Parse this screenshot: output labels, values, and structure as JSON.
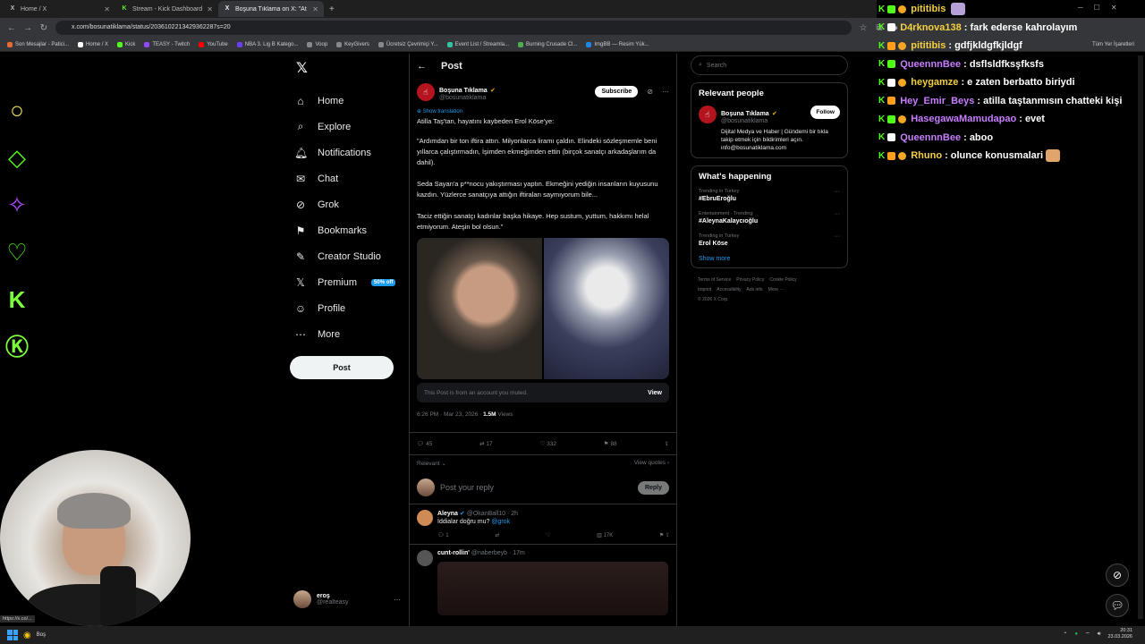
{
  "browser": {
    "tabs": [
      {
        "icon": "X",
        "label": "Home / X",
        "color": "#ffffff",
        "active": false
      },
      {
        "icon": "K",
        "label": "Stream - Kick Dashboard",
        "color": "#53fc18",
        "active": false
      },
      {
        "icon": "X",
        "label": "Boşuna Tıklama on X: \"Atilla Taş'tan...",
        "color": "#ffffff",
        "active": true
      }
    ],
    "new_tab": "+",
    "url": "x.com/bosunatiklama/status/2036102213429362287s=20",
    "bookmarks": [
      {
        "label": "Son Mesajlar - Patici...",
        "color": "#e86a33"
      },
      {
        "label": "Home / X",
        "color": "#ffffff"
      },
      {
        "label": "Kick",
        "color": "#53fc18"
      },
      {
        "label": "TEASY - Twitch",
        "color": "#9146ff"
      },
      {
        "label": "YouTube",
        "color": "#ff0000"
      },
      {
        "label": "NBA 3. Lig B Katego...",
        "color": "#6a3cff"
      },
      {
        "label": "Voop",
        "color": "#888888"
      },
      {
        "label": "KeyGivers",
        "color": "#888888"
      },
      {
        "label": "Ücretsiz Çevrimiçi Y...",
        "color": "#888888"
      },
      {
        "label": "Event List / Streamla...",
        "color": "#31c3a2"
      },
      {
        "label": "Burning Crusade Cl...",
        "color": "#4caf50"
      },
      {
        "label": "ImgBB — Resim Yük...",
        "color": "#1e88e5"
      }
    ],
    "all_bookmarks": "Tüm Yer İşaretleri",
    "status_link": "https://x.co/..."
  },
  "sidebar": {
    "logo": "𝕏",
    "items": [
      {
        "icon": "⌂",
        "label": "Home"
      },
      {
        "icon": "⌕",
        "label": "Explore"
      },
      {
        "icon": "🔔︎",
        "label": "Notifications"
      },
      {
        "icon": "✉",
        "label": "Chat"
      },
      {
        "icon": "⊘",
        "label": "Grok"
      },
      {
        "icon": "⚑",
        "label": "Bookmarks"
      },
      {
        "icon": "✎",
        "label": "Creator Studio"
      },
      {
        "icon": "𝕏",
        "label": "Premium",
        "badge": "50% off"
      },
      {
        "icon": "☺",
        "label": "Profile"
      },
      {
        "icon": "⋯",
        "label": "More"
      }
    ],
    "post_button": "Post",
    "account": {
      "name": "eroş",
      "handle": "@realteasy",
      "more": "···"
    }
  },
  "post": {
    "header_title": "Post",
    "author_name": "Boşuna Tıklama",
    "author_handle": "@bosunatiklama",
    "subscribe_label": "Subscribe",
    "show_translation": "Show translation",
    "paragraphs": [
      "Atilla Taş'tan, hayatını kaybeden Erol Köse'ye:",
      "\"Ardımdan bir ton iftira attın. Milyonlarca liramı çaldın. Elindeki sözleşmemle beni yıllarca çalıştırmadın, İşimden ekmeğimden ettin (birçok sanatçı arkadaşlarım da dahil).",
      "Seda Sayan'a p**nocu yakıştırması yaptın. Ekmeğini yediğin insanların kuyusunu kazdın. Yüzlerce sanatçıya attığın iftiraları saymıyorum bile...",
      "Taciz ettiğin sanatçı kadınlar başka hikaye. Hep sustum, yuttum, hakkımı helal etmiyorum. Ateşin bol olsun.\""
    ],
    "muted_note": "This Post is from an account you muted.",
    "muted_view": "View",
    "time": "6:26 PM · Mar 23, 2026 · ",
    "views_count": "1.5M",
    "views_label": " Views",
    "stats": {
      "replies": "45",
      "reposts": "17",
      "likes": "332",
      "bookmarks": "88"
    },
    "sort_label": "Relevant ⌄",
    "view_quotes": "View quotes ›",
    "reply_placeholder": "Post your reply",
    "reply_button": "Reply"
  },
  "comments": [
    {
      "name": "Aleyna",
      "handle": "@OkanBall10 · 2h",
      "text": "İddialar doğru mu?",
      "mention": "@grok",
      "replies": "1",
      "views": "17K",
      "avatar_color": "#d08a55"
    },
    {
      "name": "cunt-rollin'",
      "handle": "@naberbeyb · 17m",
      "text": "",
      "mention": "",
      "replies": "",
      "views": "",
      "avatar_color": "#555555"
    }
  ],
  "right": {
    "search_placeholder": "Search",
    "relevant_title": "Relevant people",
    "rp_name": "Boşuna Tıklama",
    "rp_handle": "@bosunatiklama",
    "rp_bio": "Dijital Medya ve Haber | Gündemi bir tıkla takip etmek için bildirimleri açın. info@bosunatiklama.com",
    "follow_label": "Follow",
    "happening_title": "What's happening",
    "trends": [
      {
        "category": "Trending in Turkey",
        "name": "#EbruEroğlu"
      },
      {
        "category": "Entertainment · Trending",
        "name": "#AleynaKalaycıoğlu"
      },
      {
        "category": "Trending in Turkey",
        "name": "Erol Köse"
      }
    ],
    "show_more": "Show more",
    "footer": [
      "Terms of Service",
      "Privacy Policy",
      "Cookie Policy",
      "Imprint",
      "Accessibility",
      "Ads info",
      "More ···",
      "© 2026 X Corp."
    ]
  },
  "chat": [
    {
      "user": "pititibis",
      "color": "#f4d03f",
      "message": "",
      "emote": "#b7a0d8"
    },
    {
      "user": "D4rknova138",
      "color": "#f4d03f",
      "message": ": fark ederse kahrolayım",
      "emote": ""
    },
    {
      "user": "pititibis",
      "color": "#f4d03f",
      "message": ": gdfjkldgfkjldgf",
      "emote": ""
    },
    {
      "user": "QueennnBee",
      "color": "#c77dff",
      "message": ": dsflsldfksşfksfs",
      "emote": ""
    },
    {
      "user": "heygamze",
      "color": "#f4d03f",
      "message": ": e zaten berbatto biriydi",
      "emote": ""
    },
    {
      "user": "Hey_Emir_Beys",
      "color": "#c77dff",
      "message": ": atilla taştanmısın chatteki kişi",
      "emote": ""
    },
    {
      "user": "HasegawaMamudapao",
      "color": "#c77dff",
      "message": ": evet",
      "emote": ""
    },
    {
      "user": "QueennnBee",
      "color": "#c77dff",
      "message": ": aboo",
      "emote": ""
    },
    {
      "user": "Rhuno",
      "color": "#f4d03f",
      "message": ": olunce konusmalari",
      "emote": "#e0a56a"
    }
  ],
  "taskbar": {
    "app_label": "Boş",
    "time": "20:31",
    "date": "23.03.2026"
  }
}
